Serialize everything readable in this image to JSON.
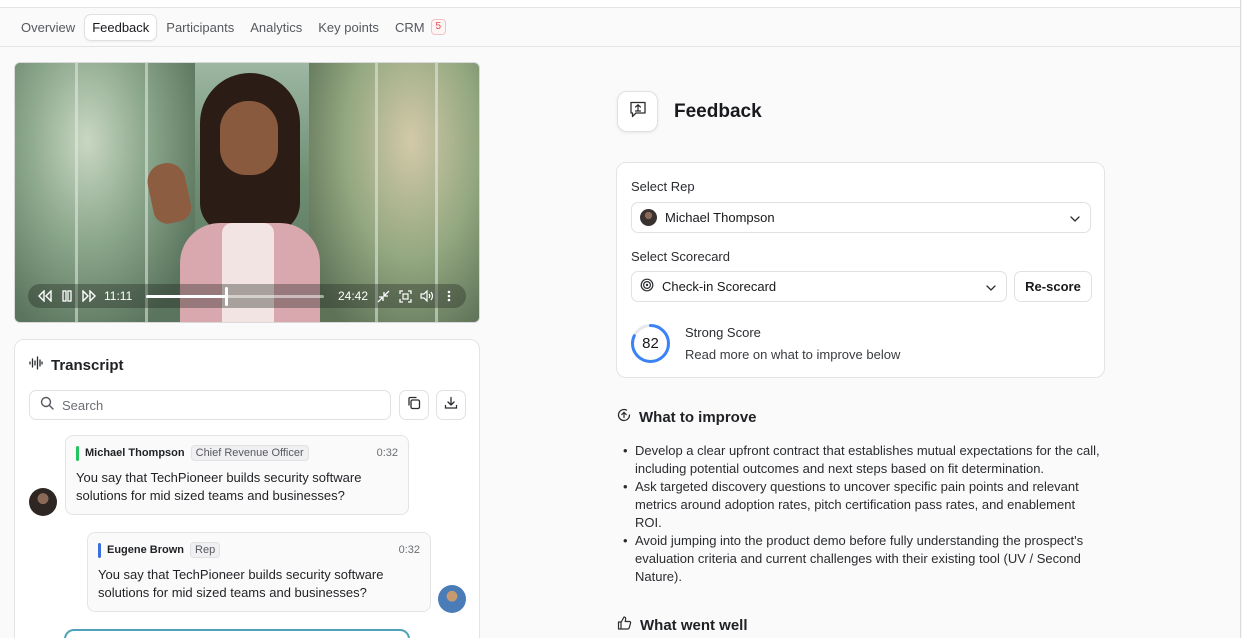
{
  "tabs": [
    {
      "label": "Overview"
    },
    {
      "label": "Feedback",
      "active": true
    },
    {
      "label": "Participants"
    },
    {
      "label": "Analytics"
    },
    {
      "label": "Key points"
    },
    {
      "label": "CRM",
      "badge": "5"
    }
  ],
  "video": {
    "current_time": "11:11",
    "duration": "24:42",
    "progress": 0.45
  },
  "transcript": {
    "title": "Transcript",
    "search_placeholder": "Search",
    "messages": [
      {
        "name": "Michael Thompson",
        "role": "Chief Revenue Officer",
        "time": "0:32",
        "text": "You say that TechPioneer builds security software solutions for mid sized teams and businesses?",
        "bar_color": "#22c55e"
      },
      {
        "name": "Eugene Brown",
        "role": "Rep",
        "time": "0:32",
        "text": "You say that TechPioneer builds security software solutions for mid sized teams and businesses?",
        "bar_color": "#3b6fe0"
      }
    ]
  },
  "feedback": {
    "title": "Feedback",
    "select_rep_label": "Select Rep",
    "rep_value": "Michael Thompson",
    "select_scorecard_label": "Select Scorecard",
    "scorecard_value": "Check-in Scorecard",
    "rescore_label": "Re-score",
    "score": "82",
    "score_fraction": 0.82,
    "score_title": "Strong Score",
    "score_subtitle": "Read more on what to improve below",
    "improve_title": "What to improve",
    "improve_items": [
      "Develop a clear upfront contract that establishes mutual expectations for the call, including potential outcomes and next steps based on fit determination.",
      "Ask targeted discovery questions to uncover specific pain points and relevant metrics around adoption rates, pitch certification pass rates, and enablement ROI.",
      "Avoid jumping into the product demo before fully understanding the prospect's evaluation criteria and current challenges with their existing tool (UV / Second Nature)."
    ],
    "went_well_title": "What went well"
  },
  "colors": {
    "accent": "#3b82f6",
    "badge_red": "#e5484d",
    "green_bar": "#22c55e",
    "blue_bar": "#3b6fe0"
  }
}
